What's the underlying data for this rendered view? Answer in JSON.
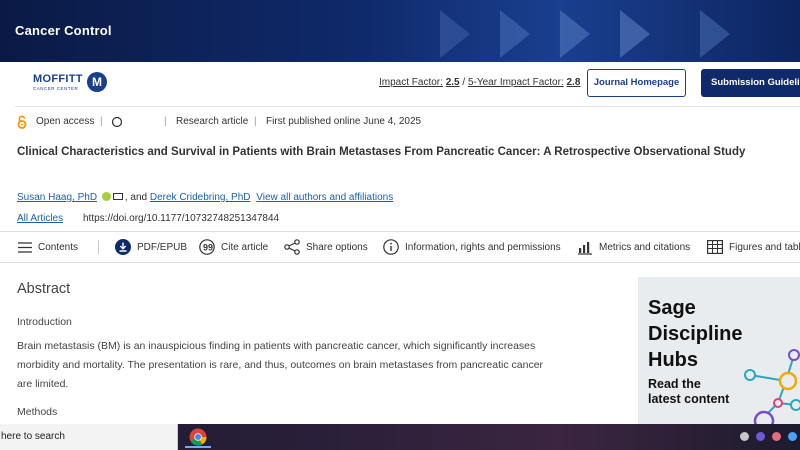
{
  "banner": {
    "title": "Cancer Control"
  },
  "header": {
    "logo_word": "MOFFITT",
    "logo_sub": "CANCER CENTER",
    "logo_mark": "M",
    "impact_label": "Impact Factor:",
    "impact_value": "2.5",
    "impact_sep": "/",
    "five_year_label": "5-Year Impact Factor:",
    "five_year_value": "2.8",
    "journal_homepage": "Journal Homepage",
    "submission_guidelines": "Submission Guidelines"
  },
  "meta": {
    "open_access": "Open access",
    "sep": "|",
    "article_type": "Research article",
    "published": "First published online June 4, 2025"
  },
  "article": {
    "title": "Clinical Characteristics and Survival in Patients with Brain Metastases From Pancreatic Cancer: A Retrospective Observational Study"
  },
  "authors": {
    "author1": "Susan Haag, PhD",
    "and": ", and",
    "author2": "Derek Cridebring, PhD",
    "view_all": "View all authors and affiliations"
  },
  "links": {
    "all_articles": "All Articles",
    "doi": "https://doi.org/10.1177/10732748251347844"
  },
  "toolbar": {
    "contents": "Contents",
    "pdf": "PDF/EPUB",
    "cite": "Cite article",
    "share": "Share options",
    "info": "Information, rights and permissions",
    "metrics": "Metrics and citations",
    "figures": "Figures and tables"
  },
  "abstract": {
    "heading": "Abstract",
    "intro_heading": "Introduction",
    "intro_text": "Brain metastasis (BM) is an inauspicious finding in patients with pancreatic cancer, which significantly increases morbidity and mortality. The presentation is rare, and thus, outcomes on brain metastases from pancreatic cancer are limited.",
    "methods_heading": "Methods"
  },
  "ad": {
    "line1": "Sage",
    "line2": "Discipline",
    "line3": "Hubs",
    "read1": "Read the",
    "read2": "latest content"
  },
  "taskbar": {
    "search_text": "here to search"
  },
  "colors": {
    "brand": "#0f2a6b",
    "link": "#1a5fb4",
    "open_access": "#f29400",
    "orcid": "#a6ce39"
  }
}
